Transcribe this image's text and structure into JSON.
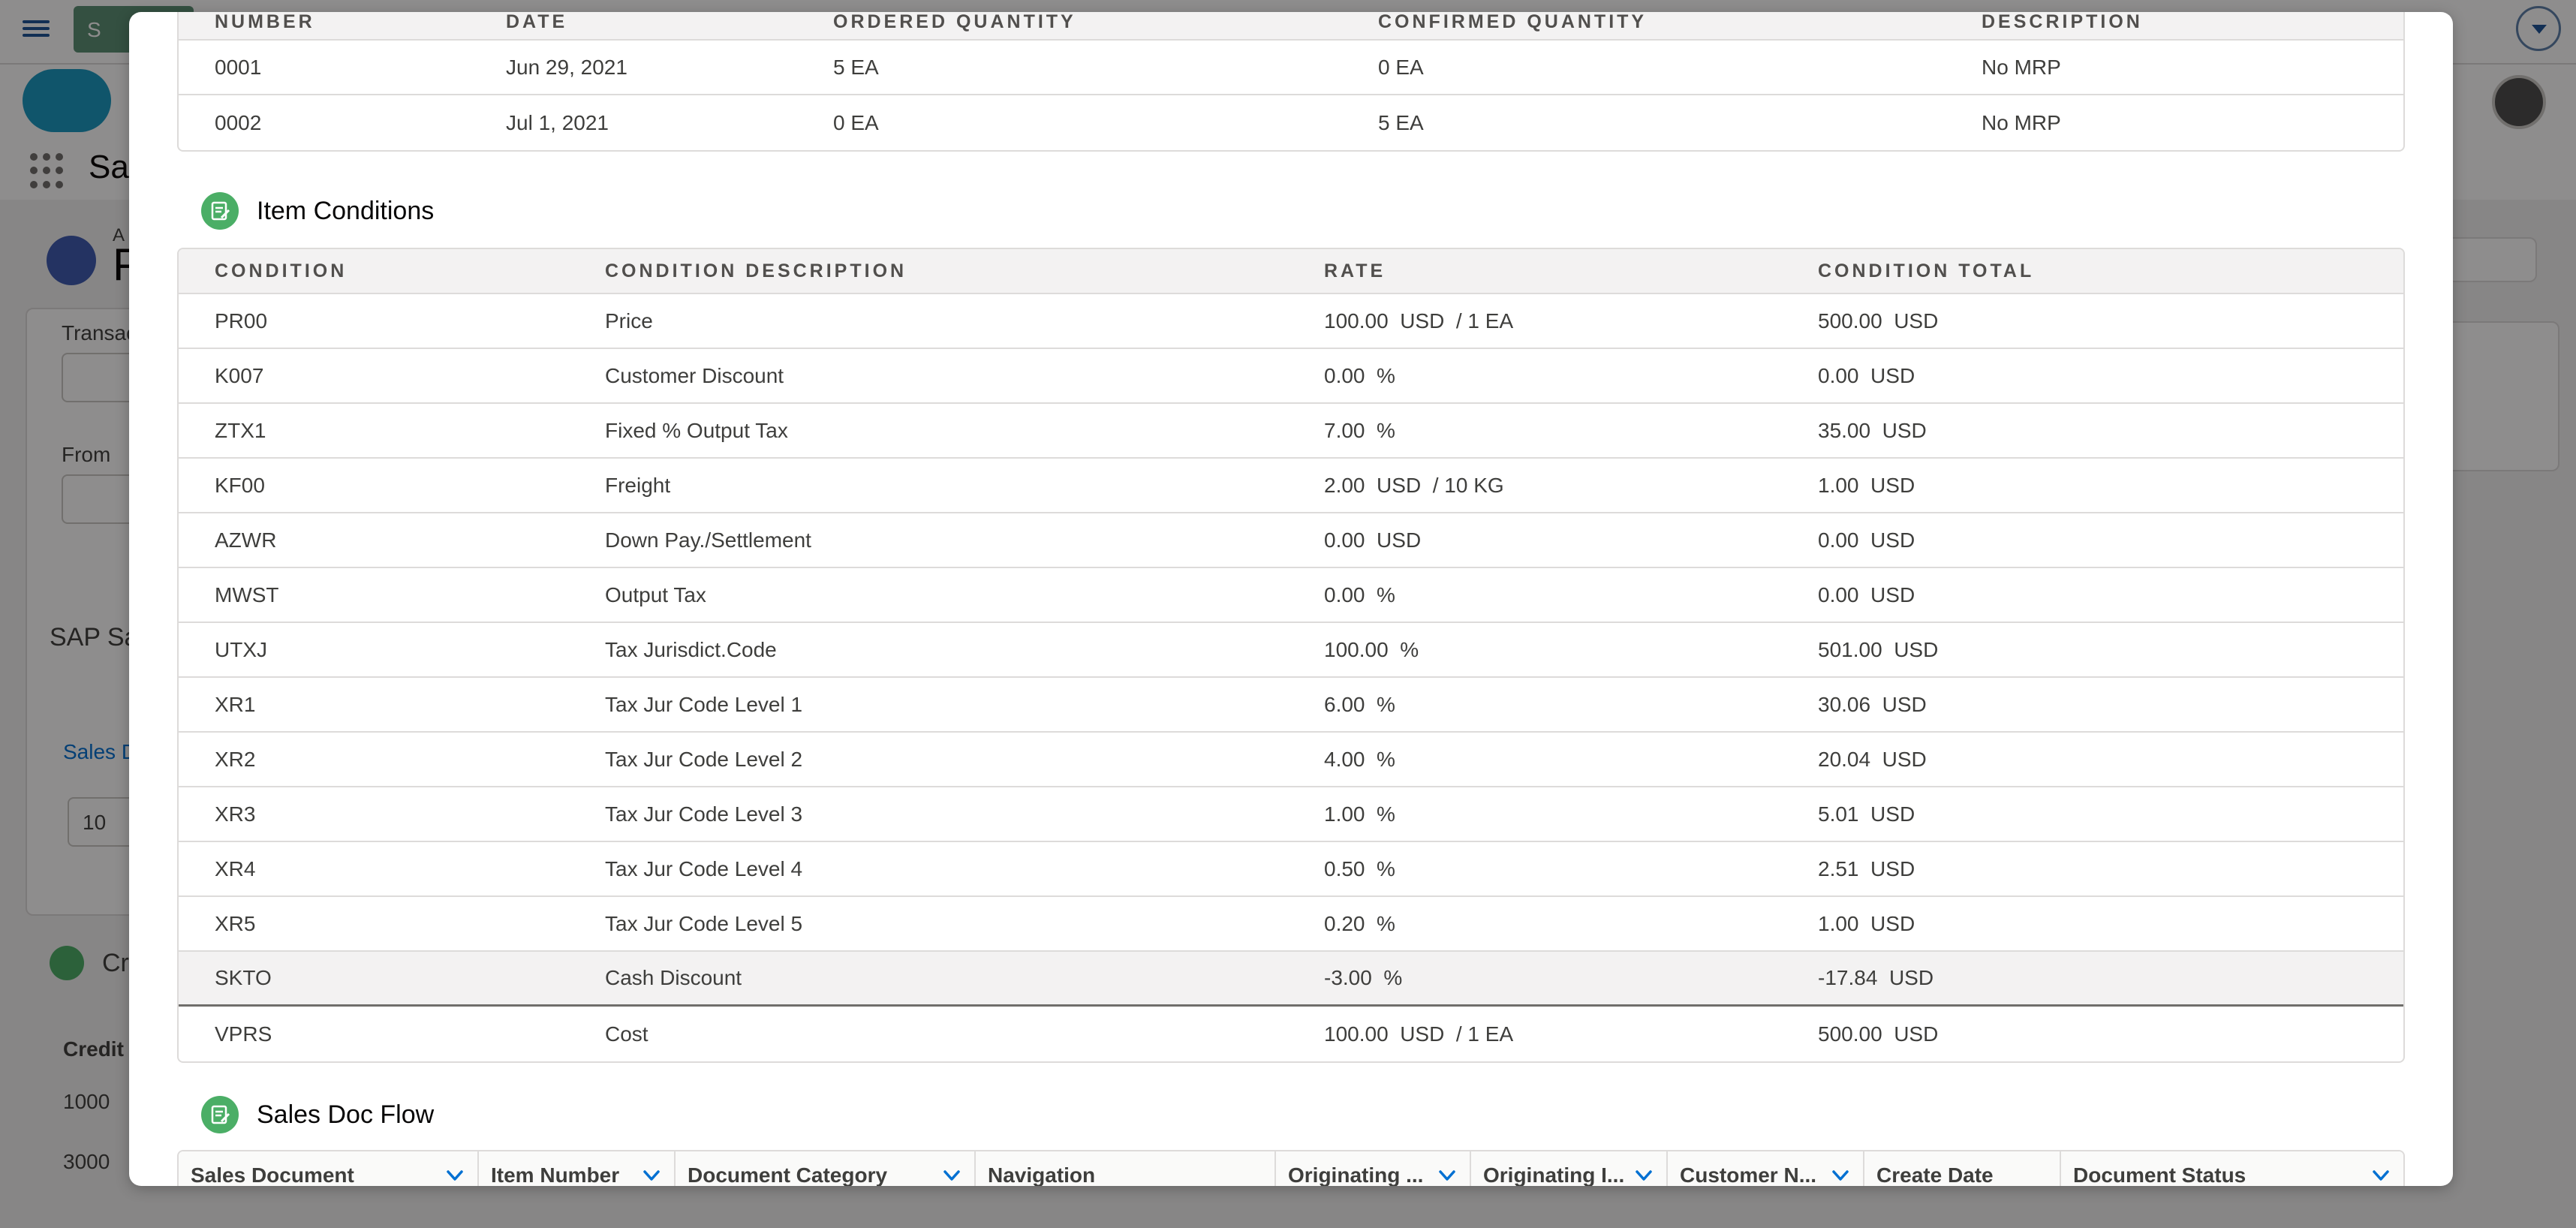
{
  "background": {
    "tab_chip_text": "S",
    "app_title": "Sal",
    "header_letter": "P",
    "header_small": "A",
    "labels": {
      "transaction": "Transac",
      "from": "From",
      "sap_section": "SAP Sa",
      "sales_link": "Sales D",
      "input_value": "10",
      "credit_section": "Cr",
      "credit_col": "Credit",
      "credit_row_1": "1000",
      "credit_row_2": "3000"
    }
  },
  "schedule_lines": {
    "headers": [
      "Number",
      "Date",
      "Ordered Quantity",
      "Confirmed Quantity",
      "Description"
    ],
    "rows": [
      [
        "0001",
        "Jun 29, 2021",
        "5 EA",
        "0 EA",
        "No MRP"
      ],
      [
        "0002",
        "Jul 1, 2021",
        "0 EA",
        "5 EA",
        "No MRP"
      ]
    ]
  },
  "item_conditions": {
    "title": "Item Conditions",
    "headers": [
      "Condition",
      "Condition Description",
      "Rate",
      "Condition Total"
    ],
    "rows": [
      [
        "PR00",
        "Price",
        "100.00  USD  / 1 EA",
        "500.00  USD"
      ],
      [
        "K007",
        "Customer Discount",
        "0.00  %",
        "0.00  USD"
      ],
      [
        "ZTX1",
        "Fixed % Output Tax",
        "7.00  %",
        "35.00  USD"
      ],
      [
        "KF00",
        "Freight",
        "2.00  USD  / 10 KG",
        "1.00  USD"
      ],
      [
        "AZWR",
        "Down Pay./Settlement",
        "0.00  USD",
        "0.00  USD"
      ],
      [
        "MWST",
        "Output Tax",
        "0.00  %",
        "0.00  USD"
      ],
      [
        "UTXJ",
        "Tax Jurisdict.Code",
        "100.00  %",
        "501.00  USD"
      ],
      [
        "XR1",
        "Tax Jur Code Level 1",
        "6.00  %",
        "30.06  USD"
      ],
      [
        "XR2",
        "Tax Jur Code Level 2",
        "4.00  %",
        "20.04  USD"
      ],
      [
        "XR3",
        "Tax Jur Code Level 3",
        "1.00  %",
        "5.01  USD"
      ],
      [
        "XR4",
        "Tax Jur Code Level 4",
        "0.50  %",
        "2.51  USD"
      ],
      [
        "XR5",
        "Tax Jur Code Level 5",
        "0.20  %",
        "1.00  USD"
      ],
      [
        "SKTO",
        "Cash Discount",
        "-3.00  %",
        "-17.84  USD"
      ],
      [
        "VPRS",
        "Cost",
        "100.00  USD  / 1 EA",
        "500.00  USD"
      ]
    ],
    "highlighted_row": 12
  },
  "sales_doc_flow": {
    "title": "Sales Doc Flow",
    "headers": [
      {
        "label": "Sales Document",
        "sortable": true
      },
      {
        "label": "Item Number",
        "sortable": true
      },
      {
        "label": "Document Category",
        "sortable": true
      },
      {
        "label": "Navigation",
        "sortable": false
      },
      {
        "label": "Originating ...",
        "sortable": true
      },
      {
        "label": "Originating I...",
        "sortable": true
      },
      {
        "label": "Customer N...",
        "sortable": true
      },
      {
        "label": "Create Date",
        "sortable": false
      },
      {
        "label": "Document Status",
        "sortable": true
      }
    ]
  },
  "colors": {
    "accent": "#0070d2",
    "section_icon": "#4bae66",
    "header_bg": "#f3f2f2",
    "border": "#dddbda"
  }
}
